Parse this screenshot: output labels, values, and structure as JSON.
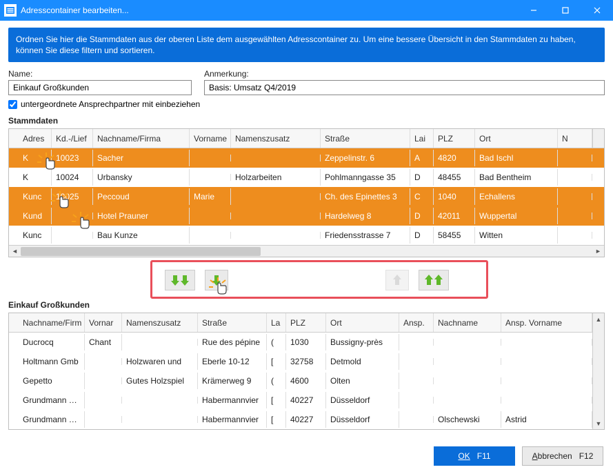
{
  "window": {
    "title": "Adresscontainer bearbeiten..."
  },
  "infobox": "Ordnen Sie hier die Stammdaten aus der oberen Liste dem ausgewählten Adresscontainer zu. Um eine bessere Übersicht in den Stammdaten zu haben, können Sie diese filtern und sortieren.",
  "form": {
    "name_label": "Name:",
    "name_value": "Einkauf Großkunden",
    "note_label": "Anmerkung:",
    "note_value": "Basis: Umsatz Q4/2019",
    "checkbox_label": "untergeordnete Ansprechpartner mit einbeziehen",
    "checkbox_checked": true
  },
  "top_grid": {
    "title": "Stammdaten",
    "headers": {
      "adres": "Adres",
      "kd": "Kd.-/Lief",
      "nachname": "Nachname/Firma",
      "vorname": "Vorname",
      "namenszusatz": "Namenszusatz",
      "strasse": "Straße",
      "land": "Lai",
      "plz": "PLZ",
      "ort": "Ort",
      "next": "N"
    },
    "rows": [
      {
        "selected": true,
        "adres": "K",
        "kd": "10023",
        "nachname": "Sacher",
        "vorname": "",
        "namenszusatz": "",
        "strasse": "Zeppelinstr. 6",
        "land": "A",
        "plz": "4820",
        "ort": "Bad Ischl"
      },
      {
        "selected": false,
        "adres": "K",
        "kd": "10024",
        "nachname": "Urbansky",
        "vorname": "",
        "namenszusatz": "Holzarbeiten",
        "strasse": "Pohlmanngasse 35",
        "land": "D",
        "plz": "48455",
        "ort": "Bad Bentheim"
      },
      {
        "selected": true,
        "adres": "Kunc",
        "kd": "10025",
        "nachname": "Peccoud",
        "vorname": "Marie",
        "namenszusatz": "",
        "strasse": "Ch. des Epinettes 3",
        "land": "C",
        "plz": "1040",
        "ort": "Echallens"
      },
      {
        "selected": true,
        "adres": "Kund",
        "kd": "",
        "nachname": "Hotel Prauner",
        "vorname": "",
        "namenszusatz": "",
        "strasse": "Hardelweg 8",
        "land": "D",
        "plz": "42011",
        "ort": "Wuppertal"
      },
      {
        "selected": false,
        "adres": "Kunc",
        "kd": "",
        "nachname": "Bau Kunze",
        "vorname": "",
        "namenszusatz": "",
        "strasse": "Friedensstrasse 7",
        "land": "D",
        "plz": "58455",
        "ort": "Witten"
      }
    ]
  },
  "bottom_grid": {
    "title": "Einkauf Großkunden",
    "headers": {
      "nachname": "Nachname/Firm",
      "vorname": "Vornar",
      "namenszusatz": "Namenszusatz",
      "strasse": "Straße",
      "land": "La",
      "plz": "PLZ",
      "ort": "Ort",
      "ansp": "Ansp.",
      "ansp_nn": "Nachname",
      "ansp_vn": "Ansp. Vorname"
    },
    "rows": [
      {
        "nachname": "Ducrocq",
        "vorname": "Chant",
        "namenszusatz": "",
        "strasse": "Rue des pépine",
        "land": "(",
        "plz": "1030",
        "ort": "Bussigny-près",
        "ansp": "",
        "ansp_nn": "",
        "ansp_vn": ""
      },
      {
        "nachname": "Holtmann Gmb",
        "vorname": "",
        "namenszusatz": "Holzwaren und",
        "strasse": "Eberle 10-12",
        "land": "[",
        "plz": "32758",
        "ort": "Detmold",
        "ansp": "",
        "ansp_nn": "",
        "ansp_vn": ""
      },
      {
        "nachname": "Gepetto",
        "vorname": "",
        "namenszusatz": "Gutes Holzspiel",
        "strasse": "Krämerweg 9",
        "land": "(",
        "plz": "4600",
        "ort": "Olten",
        "ansp": "",
        "ansp_nn": "",
        "ansp_vn": ""
      },
      {
        "nachname": "Grundmann We",
        "vorname": "",
        "namenszusatz": "",
        "strasse": "Habermannvier",
        "land": "[",
        "plz": "40227",
        "ort": "Düsseldorf",
        "ansp": "",
        "ansp_nn": "",
        "ansp_vn": ""
      },
      {
        "nachname": "Grundmann We",
        "vorname": "",
        "namenszusatz": "",
        "strasse": "Habermannvier",
        "land": "[",
        "plz": "40227",
        "ort": "Düsseldorf",
        "ansp": "",
        "ansp_nn": "Olschewski",
        "ansp_vn": "Astrid"
      }
    ]
  },
  "buttons": {
    "ok": "OK",
    "ok_key": "F11",
    "cancel": "Abbrechen",
    "cancel_key": "F12"
  }
}
